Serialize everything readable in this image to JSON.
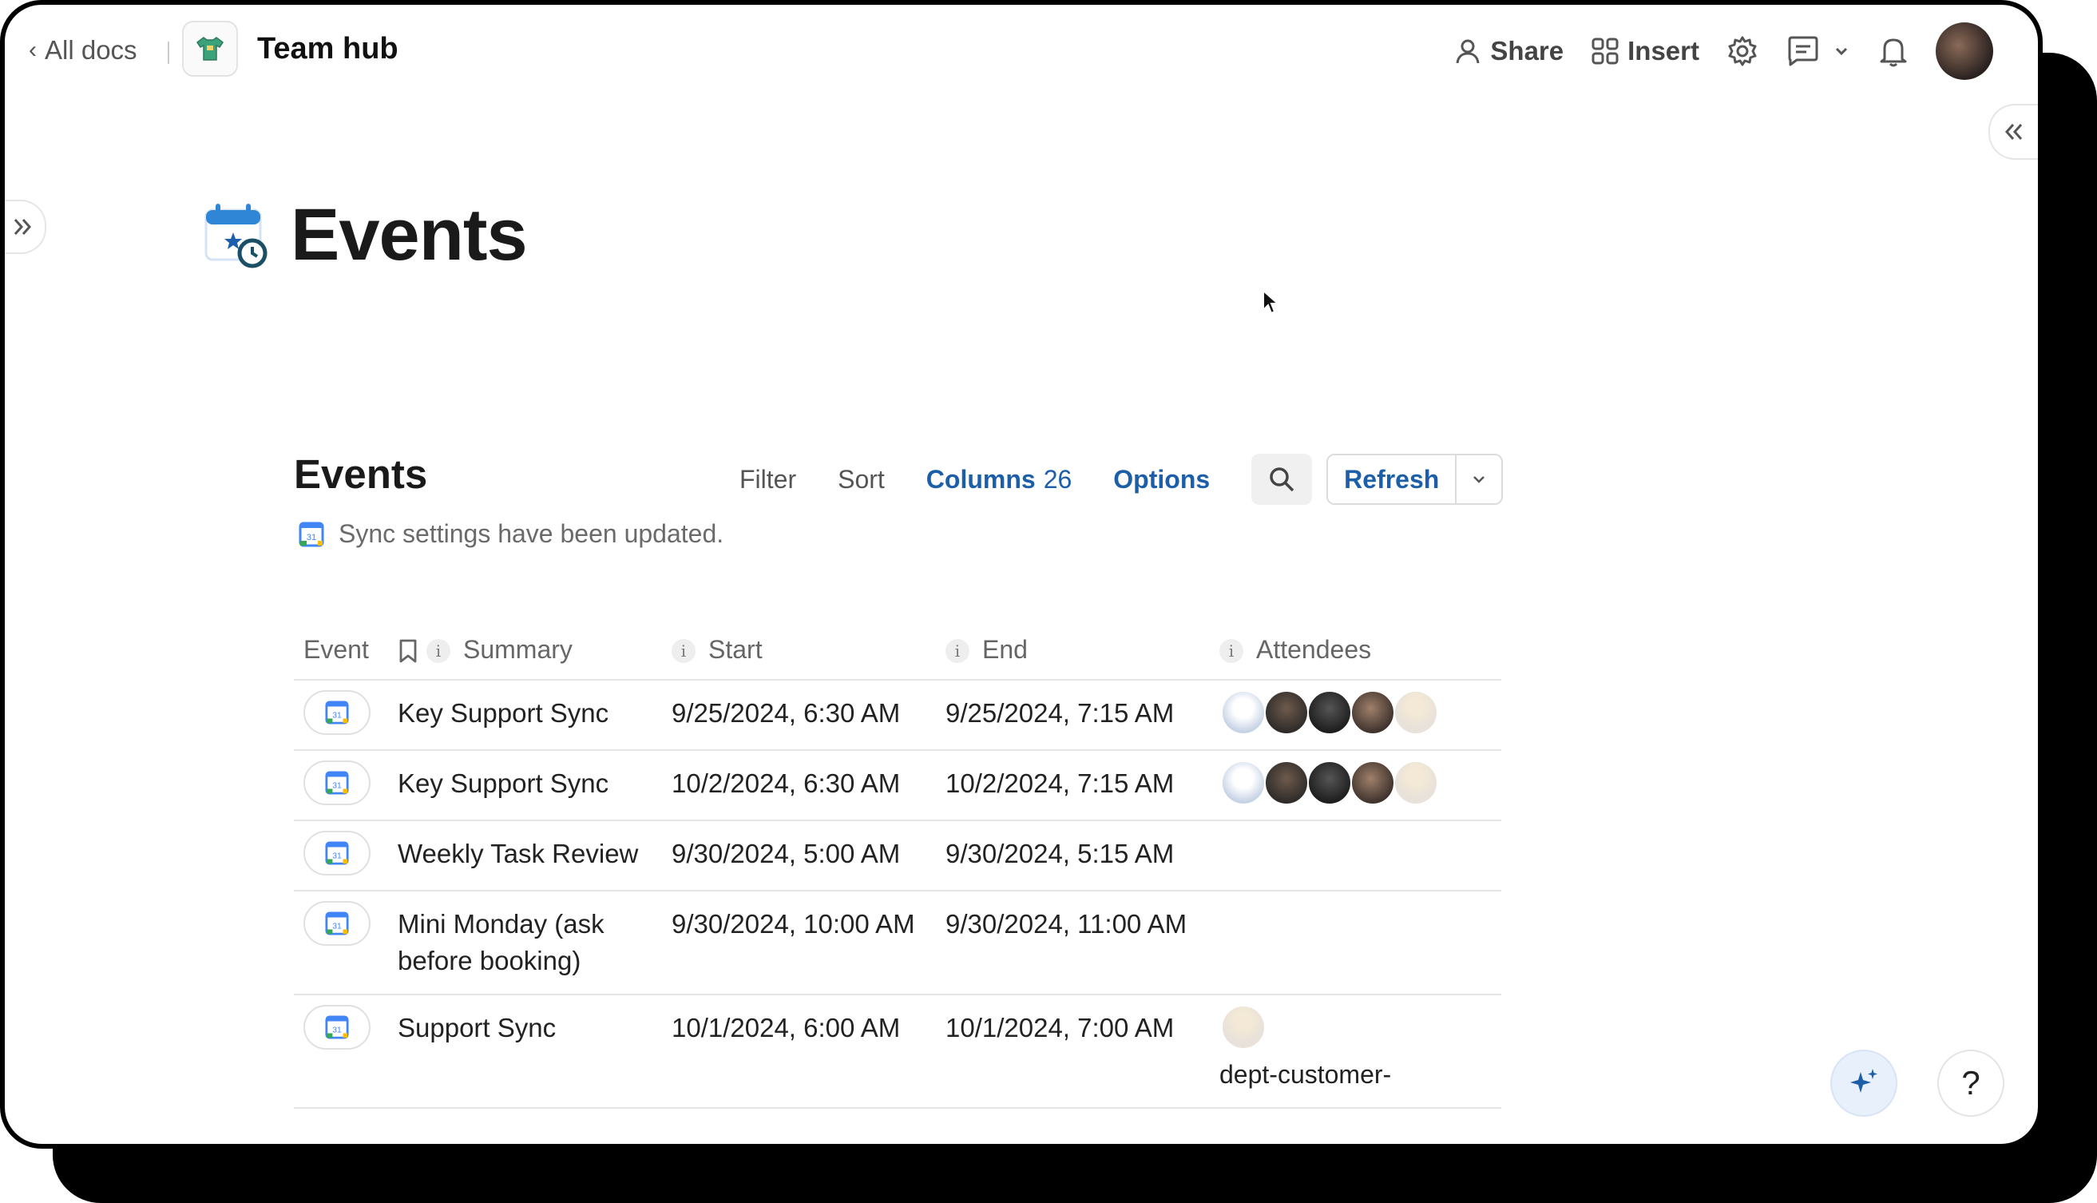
{
  "topbar": {
    "back_label": "All docs",
    "doc_title": "Team hub",
    "share_label": "Share",
    "insert_label": "Insert"
  },
  "page": {
    "title": "Events"
  },
  "table": {
    "title": "Events",
    "filter_label": "Filter",
    "sort_label": "Sort",
    "columns_label": "Columns",
    "columns_count": "26",
    "options_label": "Options",
    "refresh_label": "Refresh",
    "sync_message": "Sync settings have been updated.",
    "headers": {
      "event": "Event",
      "summary": "Summary",
      "start": "Start",
      "end": "End",
      "attendees": "Attendees"
    },
    "rows": [
      {
        "summary": "Key Support Sync",
        "start": "9/25/2024, 6:30 AM",
        "end": "9/25/2024, 7:15 AM",
        "attendees": [
          "a1",
          "a2",
          "a3",
          "a4",
          "a5"
        ],
        "attendee_text": ""
      },
      {
        "summary": "Key Support Sync",
        "start": "10/2/2024, 6:30 AM",
        "end": "10/2/2024, 7:15 AM",
        "attendees": [
          "a1",
          "a2",
          "a3",
          "a4",
          "a5"
        ],
        "attendee_text": ""
      },
      {
        "summary": "Weekly Task Review",
        "start": "9/30/2024, 5:00 AM",
        "end": "9/30/2024, 5:15 AM",
        "attendees": [],
        "attendee_text": ""
      },
      {
        "summary": "Mini Monday (ask before booking)",
        "start": "9/30/2024, 10:00 AM",
        "end": "9/30/2024, 11:00 AM",
        "attendees": [],
        "attendee_text": ""
      },
      {
        "summary": "Support Sync",
        "start": "10/1/2024, 6:00 AM",
        "end": "10/1/2024, 7:00 AM",
        "attendees": [
          "a5"
        ],
        "attendee_text": "dept-customer-"
      }
    ]
  },
  "icons": {
    "calendar_event": "google-calendar-icon",
    "ai": "sparkle-icon",
    "help": "?"
  }
}
